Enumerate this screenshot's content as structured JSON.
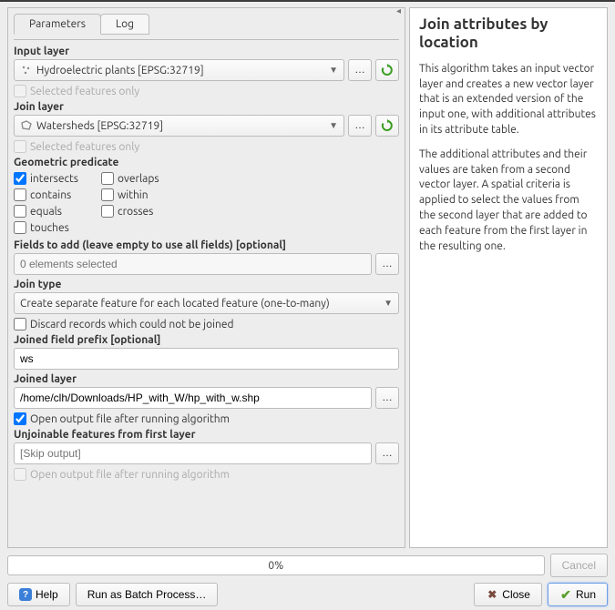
{
  "tabs": {
    "parameters": "Parameters",
    "log": "Log"
  },
  "input_layer": {
    "label": "Input layer",
    "value": "Hydroelectric plants [EPSG:32719]",
    "selected_only": "Selected features only"
  },
  "join_layer": {
    "label": "Join layer",
    "value": "Watersheds [EPSG:32719]",
    "selected_only": "Selected features only"
  },
  "predicate": {
    "label": "Geometric predicate",
    "intersects": "intersects",
    "overlaps": "overlaps",
    "contains": "contains",
    "within": "within",
    "equals": "equals",
    "crosses": "crosses",
    "touches": "touches"
  },
  "fields_to_add": {
    "label": "Fields to add (leave empty to use all fields) [optional]",
    "placeholder": "0 elements selected"
  },
  "join_type": {
    "label": "Join type",
    "value": "Create separate feature for each located feature (one-to-many)"
  },
  "discard": "Discard records which could not be joined",
  "prefix": {
    "label": "Joined field prefix [optional]",
    "value": "ws"
  },
  "joined_layer": {
    "label": "Joined layer",
    "value": "/home/clh/Downloads/HP_with_W/hp_with_w.shp"
  },
  "open_output_1": "Open output file after running algorithm",
  "unjoinable": {
    "label": "Unjoinable features from first layer",
    "placeholder": "[Skip output]"
  },
  "open_output_2": "Open output file after running algorithm",
  "help": {
    "title": "Join attributes by location",
    "p1": "This algorithm takes an input vector layer and creates a new vector layer that is an extended version of the input one, with additional attributes in its attribute table.",
    "p2": "The additional attributes and their values are taken from a second vector layer. A spatial criteria is applied to select the values from the second layer that are added to each feature from the first layer in the resulting one."
  },
  "progress": "0%",
  "buttons": {
    "cancel": "Cancel",
    "help": "Help",
    "batch": "Run as Batch Process…",
    "close": "Close",
    "run": "Run"
  }
}
